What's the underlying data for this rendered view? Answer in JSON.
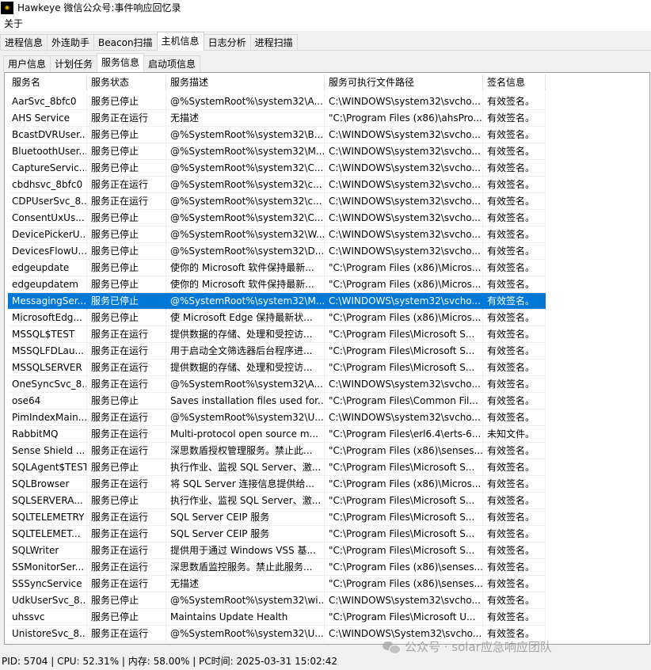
{
  "window": {
    "title": "Hawkeye 微信公众号:事件响应回忆录",
    "icon_name": "hawkeye-app-icon"
  },
  "menu": {
    "items": [
      "关于"
    ]
  },
  "main_tabs": [
    "进程信息",
    "外连助手",
    "Beacon扫描",
    "主机信息",
    "日志分析",
    "进程扫描"
  ],
  "main_tabs_active": "主机信息",
  "sub_tabs": [
    "用户信息",
    "计划任务",
    "服务信息",
    "启动项信息"
  ],
  "sub_tabs_active": "服务信息",
  "table": {
    "columns": [
      "服务名",
      "服务状态",
      "服务描述",
      "服务可执行文件路径",
      "签名信息"
    ],
    "selected_row": 12,
    "rows": [
      [
        "AarSvc_8bfc0",
        "服务已停止",
        "@%SystemRoot%\\system32\\A...",
        "C:\\WINDOWS\\system32\\svcho...",
        "有效签名。"
      ],
      [
        "AHS Service",
        "服务正在运行",
        "无描述",
        "\"C:\\Program Files (x86)\\ahsPro...",
        "有效签名。"
      ],
      [
        "BcastDVRUser...",
        "服务已停止",
        "@%SystemRoot%\\system32\\B...",
        "C:\\WINDOWS\\system32\\svcho...",
        "有效签名。"
      ],
      [
        "BluetoothUser...",
        "服务已停止",
        "@%SystemRoot%\\system32\\M...",
        "C:\\WINDOWS\\system32\\svcho...",
        "有效签名。"
      ],
      [
        "CaptureServic...",
        "服务已停止",
        "@%SystemRoot%\\system32\\C...",
        "C:\\WINDOWS\\system32\\svcho...",
        "有效签名。"
      ],
      [
        "cbdhsvc_8bfc0",
        "服务正在运行",
        "@%SystemRoot%\\system32\\c...",
        "C:\\WINDOWS\\system32\\svcho...",
        "有效签名。"
      ],
      [
        "CDPUserSvc_8...",
        "服务正在运行",
        "@%SystemRoot%\\system32\\c...",
        "C:\\WINDOWS\\system32\\svcho...",
        "有效签名。"
      ],
      [
        "ConsentUxUs...",
        "服务已停止",
        "@%SystemRoot%\\system32\\C...",
        "C:\\WINDOWS\\system32\\svcho...",
        "有效签名。"
      ],
      [
        "DevicePickerU...",
        "服务已停止",
        "@%SystemRoot%\\system32\\W...",
        "C:\\WINDOWS\\system32\\svcho...",
        "有效签名。"
      ],
      [
        "DevicesFlowU...",
        "服务已停止",
        "@%SystemRoot%\\system32\\D...",
        "C:\\WINDOWS\\system32\\svcho...",
        "有效签名。"
      ],
      [
        "edgeupdate",
        "服务已停止",
        "使你的 Microsoft 软件保持最新...",
        "\"C:\\Program Files (x86)\\Micros...",
        "有效签名。"
      ],
      [
        "edgeupdatem",
        "服务已停止",
        "使你的 Microsoft 软件保持最新...",
        "\"C:\\Program Files (x86)\\Micros...",
        "有效签名。"
      ],
      [
        "MessagingSer...",
        "服务已停止",
        "@%SystemRoot%\\system32\\M...",
        "C:\\WINDOWS\\system32\\svcho...",
        "有效签名。"
      ],
      [
        "MicrosoftEdg...",
        "服务已停止",
        "使 Microsoft Edge 保持最新状...",
        "\"C:\\Program Files (x86)\\Micros...",
        "有效签名。"
      ],
      [
        "MSSQL$TEST",
        "服务正在运行",
        "提供数据的存储、处理和受控访...",
        "\"C:\\Program Files\\Microsoft S...",
        "有效签名。"
      ],
      [
        "MSSQLFDLau...",
        "服务正在运行",
        "用于启动全文筛选器后台程序进...",
        "\"C:\\Program Files\\Microsoft S...",
        "有效签名。"
      ],
      [
        "MSSQLSERVER",
        "服务正在运行",
        "提供数据的存储、处理和受控访...",
        "\"C:\\Program Files\\Microsoft S...",
        "有效签名。"
      ],
      [
        "OneSyncSvc_8...",
        "服务正在运行",
        "@%SystemRoot%\\system32\\A...",
        "C:\\WINDOWS\\system32\\svcho...",
        "有效签名。"
      ],
      [
        "ose64",
        "服务已停止",
        "Saves installation files used for...",
        "\"C:\\Program Files\\Common Fil...",
        "有效签名。"
      ],
      [
        "PimIndexMain...",
        "服务正在运行",
        "@%SystemRoot%\\system32\\U...",
        "C:\\WINDOWS\\system32\\svcho...",
        "有效签名。"
      ],
      [
        "RabbitMQ",
        "服务正在运行",
        "Multi-protocol open source m...",
        "\"C:\\Program Files\\erl6.4\\erts-6...",
        "未知文件。"
      ],
      [
        "Sense Shield ...",
        "服务正在运行",
        "深思数盾授权管理服务。禁止此...",
        "\"C:\\Program Files (x86)\\senses...",
        "有效签名。"
      ],
      [
        "SQLAgent$TEST",
        "服务已停止",
        "执行作业、监视 SQL Server、激...",
        "\"C:\\Program Files\\Microsoft S...",
        "有效签名。"
      ],
      [
        "SQLBrowser",
        "服务正在运行",
        "将 SQL Server 连接信息提供给...",
        "\"C:\\Program Files (x86)\\Micros...",
        "有效签名。"
      ],
      [
        "SQLSERVERA...",
        "服务已停止",
        "执行作业、监视 SQL Server、激...",
        "\"C:\\Program Files\\Microsoft S...",
        "有效签名。"
      ],
      [
        "SQLTELEMETRY",
        "服务正在运行",
        "SQL Server CEIP 服务",
        "\"C:\\Program Files\\Microsoft S...",
        "有效签名。"
      ],
      [
        "SQLTELEMET...",
        "服务正在运行",
        "SQL Server CEIP 服务",
        "\"C:\\Program Files\\Microsoft S...",
        "有效签名。"
      ],
      [
        "SQLWriter",
        "服务正在运行",
        "提供用于通过 Windows VSS 基...",
        "\"C:\\Program Files\\Microsoft S...",
        "有效签名。"
      ],
      [
        "SSMonitorSer...",
        "服务正在运行",
        "深思数盾监控服务。禁止此服务...",
        "\"C:\\Program Files (x86)\\senses...",
        "有效签名。"
      ],
      [
        "SSSyncService",
        "服务正在运行",
        "无描述",
        "\"C:\\Program Files (x86)\\senses...",
        "有效签名。"
      ],
      [
        "UdkUserSvc_8...",
        "服务已停止",
        "@%SystemRoot%\\system32\\wi...",
        "C:\\WINDOWS\\system32\\svcho...",
        "有效签名。"
      ],
      [
        "uhssvc",
        "服务已停止",
        "Maintains Update Health",
        "\"C:\\Program Files\\Microsoft U...",
        "有效签名。"
      ],
      [
        "UnistoreSvc_8...",
        "服务正在运行",
        "@%SystemRoot%\\system32\\U...",
        "C:\\WINDOWS\\System32\\svcho...",
        "有效签名。"
      ]
    ]
  },
  "status_bar": "PID: 5704 | CPU: 52.31% | 内存: 58.00% | PC时间: 2025-03-31 15:02:42",
  "watermark": {
    "text": "公众号 · solar应急响应团队",
    "icon_name": "wechat-icon"
  },
  "colors": {
    "selection": "#0078d7",
    "window_bg": "#f0f0f0",
    "list_bg": "#ffffff"
  }
}
